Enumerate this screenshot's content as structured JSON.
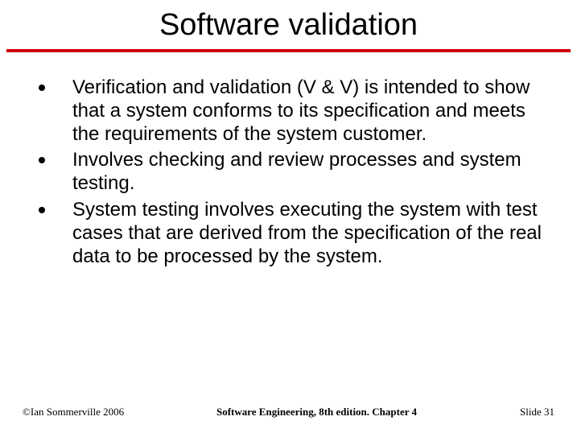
{
  "title": "Software validation",
  "bullets": [
    "Verification and validation (V & V) is intended to show that a system conforms to its specification and meets the requirements of the system customer.",
    "Involves checking and review processes and system testing.",
    "System testing involves executing the system with test cases that are derived from the specification of the real data to be processed by the system."
  ],
  "footer": {
    "left": "©Ian Sommerville 2006",
    "center": "Software Engineering, 8th edition. Chapter 4",
    "right": "Slide 31"
  }
}
